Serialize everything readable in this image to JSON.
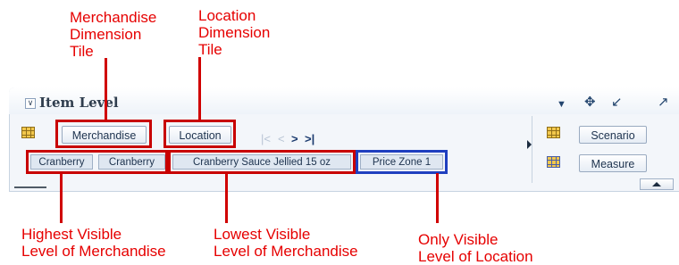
{
  "callouts": {
    "merchandise_tile": [
      "Merchandise",
      "Dimension",
      "Tile"
    ],
    "location_tile": [
      "Location",
      "Dimension",
      "Tile"
    ],
    "highest_level": [
      "Highest Visible",
      "Level of Merchandise"
    ],
    "lowest_level": [
      "Lowest Visible",
      "Level of Merchandise"
    ],
    "only_location": [
      "Only Visible",
      "Level of Location"
    ]
  },
  "panel": {
    "title": "Item Level",
    "collapse_icon": "collapse-icon",
    "toolbar_icons": [
      "dropdown-arrow-icon",
      "move-icon",
      "restore-icon",
      "expand-icon"
    ]
  },
  "row_tiles": {
    "merchandise": "Merchandise",
    "location": "Location",
    "nav_icons": [
      "first-page-icon",
      "previous-icon",
      "next-icon",
      "last-page-icon"
    ]
  },
  "members": {
    "merch_level_1": "Cranberry",
    "merch_level_2": "Cranberry",
    "merch_level_3": "Cranberry Sauce Jellied 15 oz",
    "location_level": "Price Zone 1"
  },
  "column_tiles": {
    "scenario": "Scenario",
    "measure": "Measure"
  },
  "colors": {
    "callout_red": "#e60000",
    "highlight_red": "#c80000",
    "highlight_blue": "#1f3fbf"
  }
}
